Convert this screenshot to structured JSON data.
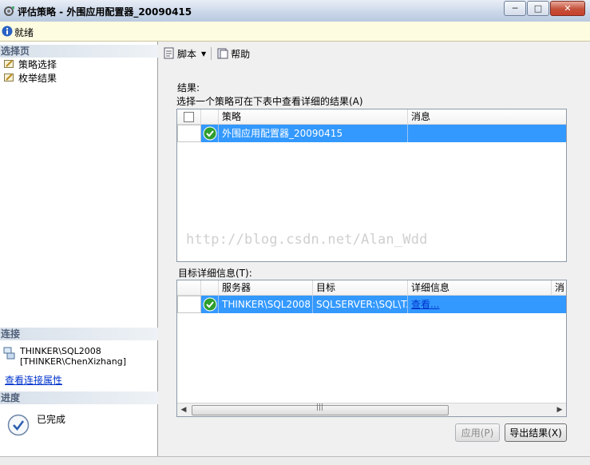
{
  "window": {
    "title": "评估策略 - 外围应用配置器_20090415"
  },
  "status": {
    "text": "就绪"
  },
  "sidebar": {
    "select_page_header": "选择页",
    "pages": [
      {
        "label": "策略选择"
      },
      {
        "label": "枚举结果"
      }
    ],
    "connection_header": "连接",
    "server": "THINKER\\SQL2008",
    "user": "[THINKER\\ChenXizhang]",
    "view_connection_link": "查看连接属性",
    "progress_header": "进度",
    "progress_status": "已完成"
  },
  "toolbar": {
    "script_label": "脚本",
    "help_label": "帮助"
  },
  "results": {
    "label": "结果:",
    "instruction": "选择一个策略可在下表中查看详细的结果(A)",
    "columns": [
      "策略",
      "消息"
    ],
    "rows": [
      {
        "policy": "外围应用配置器_20090415",
        "message": ""
      }
    ]
  },
  "details": {
    "label": "目标详细信息(T):",
    "columns": [
      "服务器",
      "目标",
      "详细信息",
      "消"
    ],
    "rows": [
      {
        "server": "THINKER\\SQL2008",
        "target": "SQLSERVER:\\SQL\\T...",
        "details_link": "查看..."
      }
    ]
  },
  "watermark": "http://blog.csdn.net/Alan_Wdd",
  "buttons": {
    "apply": "应用(P)",
    "export": "导出结果(X)"
  },
  "colors": {
    "selection": "#3399ff",
    "success": "#2e9e2e",
    "link": "#0033cc"
  }
}
